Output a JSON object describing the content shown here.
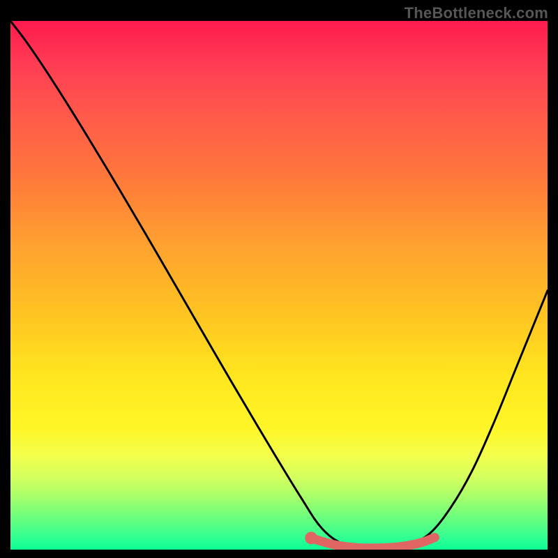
{
  "watermark": "TheBottleneck.com",
  "chart_data": {
    "type": "line",
    "title": "",
    "xlabel": "",
    "ylabel": "",
    "xlim": [
      0,
      100
    ],
    "ylim": [
      0,
      100
    ],
    "series": [
      {
        "name": "bottleneck-curve",
        "x": [
          0,
          3,
          7,
          12,
          18,
          25,
          33,
          41,
          48,
          54,
          58,
          62,
          66,
          70,
          74,
          78,
          82,
          86,
          90,
          94,
          98,
          100
        ],
        "y": [
          100,
          96,
          90,
          82,
          72,
          60,
          46,
          32,
          20,
          10,
          4,
          1,
          0,
          0,
          1,
          3,
          8,
          15,
          24,
          34,
          44,
          49
        ]
      },
      {
        "name": "highlight-segment",
        "x": [
          56,
          60,
          64,
          68,
          72,
          76,
          79
        ],
        "y": [
          2.2,
          1.0,
          0.4,
          0.3,
          0.5,
          1.2,
          2.3
        ]
      }
    ],
    "marker": {
      "x": 56,
      "y": 2.2
    },
    "colors": {
      "curve": "#000000",
      "highlight": "#e06664",
      "marker": "#e06664"
    }
  }
}
